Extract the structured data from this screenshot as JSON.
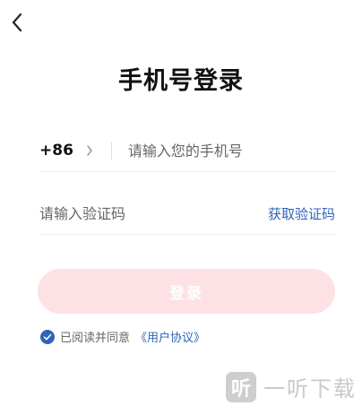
{
  "header": {
    "title": "手机号登录"
  },
  "phone": {
    "country_code": "+86",
    "placeholder": "请输入您的手机号"
  },
  "code": {
    "placeholder": "请输入验证码",
    "get_code_label": "获取验证码"
  },
  "login": {
    "label": "登录"
  },
  "agreement": {
    "checked": true,
    "text": "已阅读并同意",
    "link": "《用户协议》"
  },
  "watermark": {
    "logo_char": "听",
    "text": "一听下载"
  },
  "colors": {
    "accent": "#2f64b8",
    "button_disabled": "#fde1e5"
  }
}
